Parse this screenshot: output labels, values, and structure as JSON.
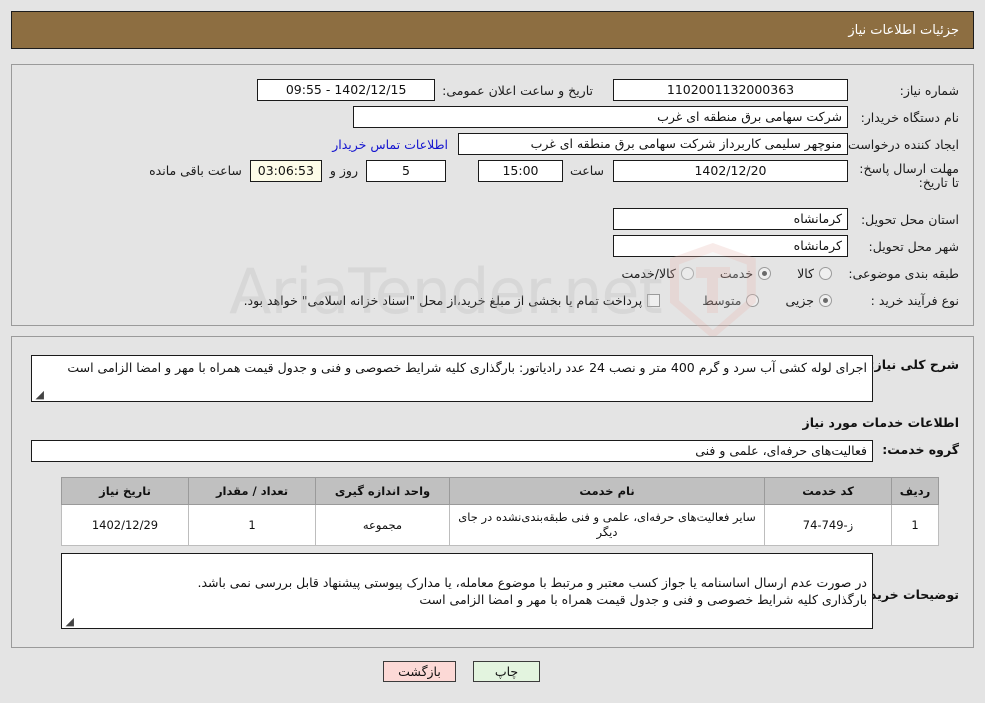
{
  "header": {
    "title": "جزئیات اطلاعات نیاز"
  },
  "form": {
    "need_number_label": "شماره نیاز:",
    "need_number_value": "1102001132000363",
    "announce_label": "تاریخ و ساعت اعلان عمومی:",
    "announce_value": "1402/12/15 - 09:55",
    "buyer_org_label": "نام دستگاه خریدار:",
    "buyer_org_value": "شرکت سهامی برق منطقه ای غرب",
    "creator_label": "ایجاد کننده درخواست:",
    "creator_value": "منوچهر  سلیمی کاربرداز شرکت سهامی برق منطقه ای غرب",
    "contact_link": "اطلاعات تماس خریدار",
    "deadline_label": "مهلت ارسال پاسخ: تا تاریخ:",
    "deadline_date": "1402/12/20",
    "hour_label": "ساعت",
    "hour_value": "15:00",
    "days_value": "5",
    "days_label": "روز و",
    "remaining_value": "03:06:53",
    "remaining_label": "ساعت باقی مانده",
    "province_label": "استان محل تحویل:",
    "province_value": "کرمانشاه",
    "city_label": "شهر محل تحویل:",
    "city_value": "کرمانشاه",
    "category_label": "طبقه بندی موضوعی:",
    "category_options": [
      {
        "label": "کالا",
        "selected": false
      },
      {
        "label": "خدمت",
        "selected": true
      },
      {
        "label": "کالا/خدمت",
        "selected": false
      }
    ],
    "process_label": "نوع فرآیند خرید :",
    "process_options": [
      {
        "label": "جزیی",
        "selected": true
      },
      {
        "label": "متوسط",
        "selected": false
      }
    ],
    "treasury_checkbox_label": "پرداخت تمام یا بخشی از مبلغ خرید،از محل \"اسناد خزانه اسلامی\" خواهد بود."
  },
  "description": {
    "label": "شرح کلی نیاز:",
    "value": "اجرای لوله کشی آب سرد و گرم 400 متر و نصب 24 عدد رادیاتور: بارگذاری کلیه شرایط خصوصی و فنی و جدول قیمت همراه با مهر و امضا الزامی است"
  },
  "services_section": {
    "heading": "اطلاعات خدمات مورد نیاز",
    "group_label": "گروه خدمت:",
    "group_value": "فعالیت‌های حرفه‌ای، علمی و فنی"
  },
  "table": {
    "columns": [
      "ردیف",
      "کد خدمت",
      "نام خدمت",
      "واحد اندازه گیری",
      "تعداد / مقدار",
      "تاریخ نیاز"
    ],
    "rows": [
      {
        "row_no": "1",
        "service_code": "ز-749-74",
        "service_name": "سایر فعالیت‌های حرفه‌ای، علمی و فنی طبقه‌بندی‌نشده در جای دیگر",
        "unit": "مجموعه",
        "quantity": "1",
        "need_date": "1402/12/29"
      }
    ]
  },
  "buyer_notes": {
    "label": "توضیحات خریدار:",
    "value": "در صورت عدم ارسال اساسنامه یا جواز کسب معتبر و مرتبط با موضوع معامله،  یا مدارک پیوستی پیشنهاد قابل بررسی نمی باشد.\nبارگذاری کلیه شرایط خصوصی و فنی و جدول قیمت همراه با مهر و امضا الزامی است"
  },
  "footer": {
    "print_label": "چاپ",
    "back_label": "بازگشت"
  },
  "watermark": {
    "text": "AriaTender.net"
  },
  "colors": {
    "header_bg": "#8d6e41",
    "link": "#1414cf",
    "table_header_bg": "#c0c0c0",
    "print_btn_bg": "#e3f4df",
    "back_btn_bg": "#fcd9d6"
  }
}
